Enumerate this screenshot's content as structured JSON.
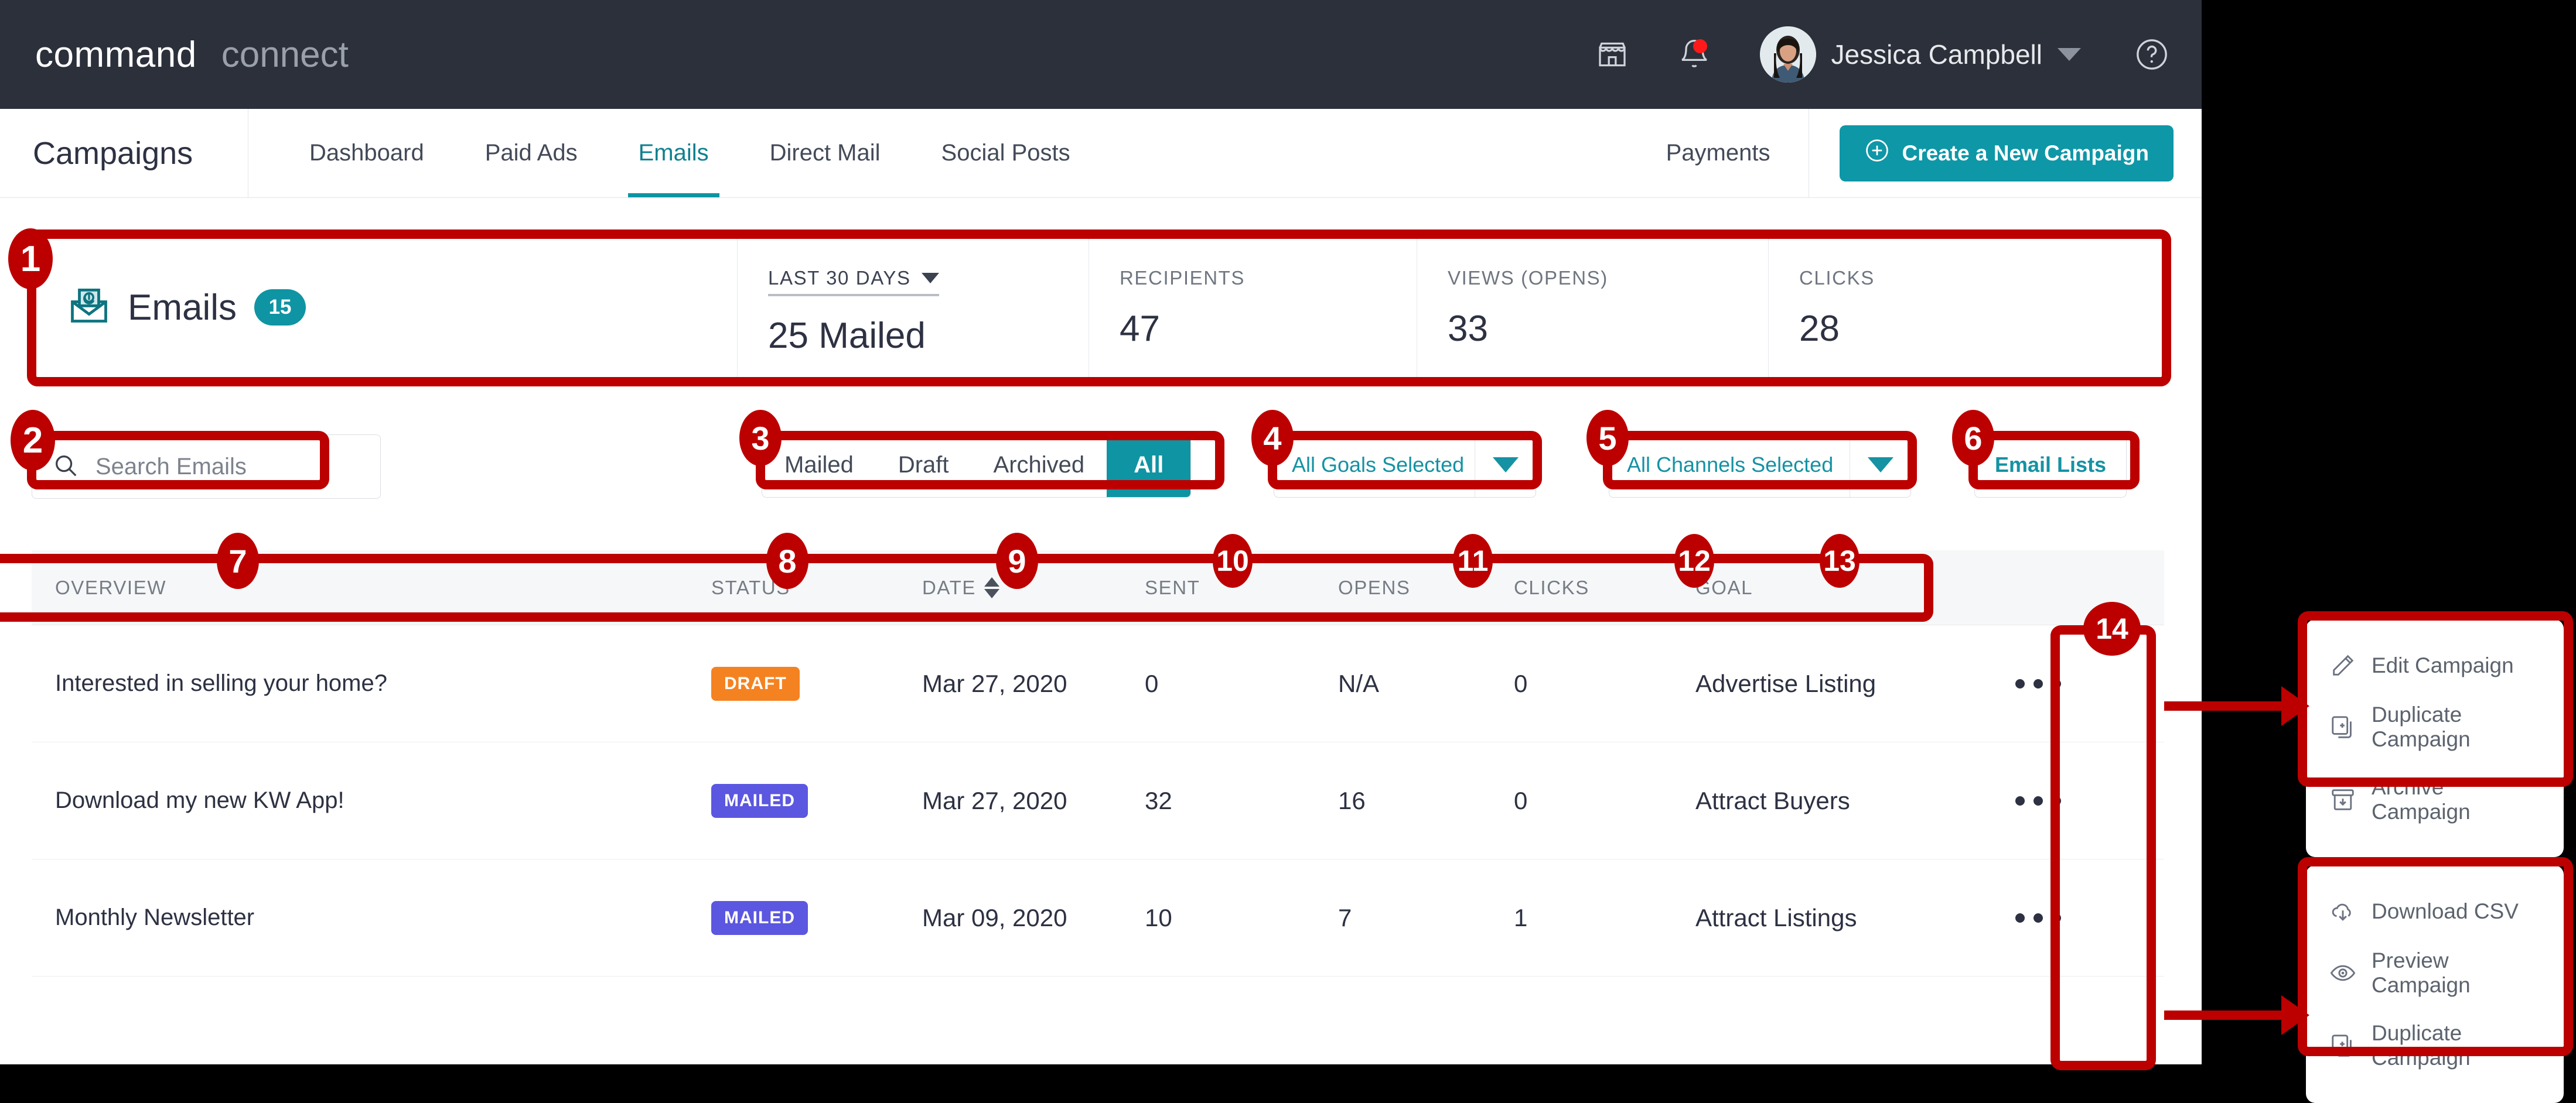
{
  "topbar": {
    "brand_primary": "command",
    "brand_secondary": "connect",
    "store_icon": "storefront-icon",
    "notifications_icon": "bell-icon",
    "user_name": "Jessica Campbell",
    "user_caret_icon": "chevron-down-icon",
    "help_icon": "question-circle-icon"
  },
  "nav": {
    "title": "Campaigns",
    "items": [
      {
        "label": "Dashboard",
        "active": false
      },
      {
        "label": "Paid Ads",
        "active": false
      },
      {
        "label": "Emails",
        "active": true
      },
      {
        "label": "Direct Mail",
        "active": false
      },
      {
        "label": "Social Posts",
        "active": false
      }
    ],
    "payments_label": "Payments",
    "create_button_label": "Create a New Campaign",
    "create_button_icon": "plus-circle-icon",
    "accent_color": "#0e97a7"
  },
  "stats": {
    "section_title": "Emails",
    "section_icon": "email-at-icon",
    "count_badge": "15",
    "range": {
      "label": "LAST 30 DAYS",
      "value": "25 Mailed",
      "caret_icon": "caret-down-icon"
    },
    "metrics": [
      {
        "label": "RECIPIENTS",
        "value": "47"
      },
      {
        "label": "VIEWS (OPENS)",
        "value": "33"
      },
      {
        "label": "CLICKS",
        "value": "28"
      }
    ]
  },
  "filters": {
    "search_placeholder": "Search Emails",
    "search_icon": "search-icon",
    "segments": [
      {
        "label": "Mailed",
        "active": false
      },
      {
        "label": "Draft",
        "active": false
      },
      {
        "label": "Archived",
        "active": false
      },
      {
        "label": "All",
        "active": true
      }
    ],
    "goals_dropdown": "All Goals Selected",
    "channels_dropdown": "All Channels Selected",
    "email_lists_label": "Email Lists"
  },
  "table": {
    "headers": {
      "overview": "OVERVIEW",
      "status": "STATUS",
      "date": "DATE",
      "sent": "SENT",
      "opens": "OPENS",
      "clicks": "CLICKS",
      "goal": "GOAL"
    },
    "date_sort_icon": "sort-updown-icon",
    "rows": [
      {
        "title": "Interested in selling your home?",
        "status": "DRAFT",
        "status_color": "#f58220",
        "date": "Mar 27, 2020",
        "sent": "0",
        "opens": "N/A",
        "clicks": "0",
        "goal": "Advertise Listing",
        "more_icon": "ellipsis-icon"
      },
      {
        "title": "Download my new KW App!",
        "status": "MAILED",
        "status_color": "#5b57e0",
        "date": "Mar 27, 2020",
        "sent": "32",
        "opens": "16",
        "clicks": "0",
        "goal": "Attract Buyers",
        "more_icon": "ellipsis-icon"
      },
      {
        "title": "Monthly Newsletter",
        "status": "MAILED",
        "status_color": "#5b57e0",
        "date": "Mar 09, 2020",
        "sent": "10",
        "opens": "7",
        "clicks": "1",
        "goal": "Attract Listings",
        "more_icon": "ellipsis-icon"
      }
    ]
  },
  "popup_draft": {
    "items": [
      {
        "label": "Edit Campaign",
        "icon": "pencil-icon"
      },
      {
        "label": "Duplicate Campaign",
        "icon": "duplicate-icon"
      },
      {
        "label": "Archive Campaign",
        "icon": "archive-icon"
      }
    ]
  },
  "popup_mailed": {
    "items": [
      {
        "label": "Download CSV",
        "icon": "cloud-download-icon"
      },
      {
        "label": "Preview Campaign",
        "icon": "eye-icon"
      },
      {
        "label": "Duplicate Campaign",
        "icon": "duplicate-icon"
      }
    ]
  },
  "annotations": {
    "color": "#bc0000",
    "markers": [
      "1",
      "2",
      "3",
      "4",
      "5",
      "6",
      "7",
      "8",
      "9",
      "10",
      "11",
      "12",
      "13",
      "14"
    ]
  }
}
